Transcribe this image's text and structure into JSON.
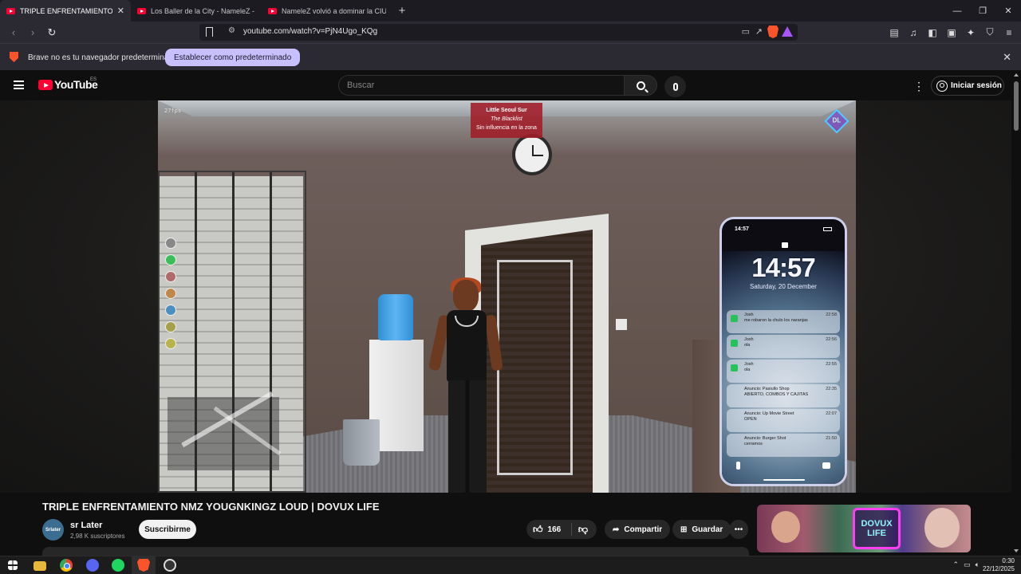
{
  "browser": {
    "tabs": [
      {
        "label": "TRIPLE ENFRENTAMIENTO NMZ",
        "active": true
      },
      {
        "label": "Los Baller de la City - NameleZ - You",
        "active": false
      },
      {
        "label": "NameleZ volvió a dominar la CIUDAD",
        "active": false
      }
    ],
    "new_tab": "+",
    "url": "youtube.com/watch?v=PjN4Ugo_KQg",
    "banner_message": "Brave no es tu navegador predeterminado",
    "banner_button": "Establecer como predeterminado",
    "brand_color": "#fb542b"
  },
  "youtube": {
    "logo_text": "YouTube",
    "country_code": "ES",
    "search_placeholder": "Buscar",
    "signin_label": "Iniciar sesión",
    "accent_color": "#ff0033"
  },
  "video": {
    "fps_overlay": "27fps",
    "zone": {
      "title": "Little Seoul Sur",
      "subtitle": "The Blacklist",
      "status": "Sin influencia en la zona"
    },
    "server_logo": "DL",
    "phone": {
      "status_time": "14:57",
      "lock_time": "14:57",
      "date": "Saturday, 20 December",
      "notifications": [
        {
          "title": "Josh",
          "body": "me robaron la chulo los naranjas",
          "time": "22:58"
        },
        {
          "title": "Josh",
          "body": "ola",
          "time": "22:56"
        },
        {
          "title": "Josh",
          "body": "ola",
          "time": "22:55"
        },
        {
          "title": "Anuncio: Pasiullo Shop",
          "body": "ABIERTO, COMBOS Y CAJITAS",
          "time": "22:35"
        },
        {
          "title": "Anuncio: Up Movie Street",
          "body": "OPEN",
          "time": "22:07"
        },
        {
          "title": "Anuncio: Burger Shot",
          "body": "cerramos",
          "time": "21:50"
        }
      ]
    }
  },
  "watch": {
    "title": "TRIPLE ENFRENTAMIENTO NMZ YOUGNKINGZ LOUD | DOVUX LIFE",
    "channel_avatar_text": "Srlater",
    "channel_name": "sr Later",
    "subscribers": "2,98 K suscriptores",
    "subscribe_label": "Suscribirme",
    "like_count": "166",
    "share_label": "Compartir",
    "save_label": "Guardar",
    "more_label": "•••",
    "next_thumbnail_logo": "DOVUX LIFE"
  },
  "taskbar": {
    "time": "0:30",
    "date": "22/12/2025"
  }
}
